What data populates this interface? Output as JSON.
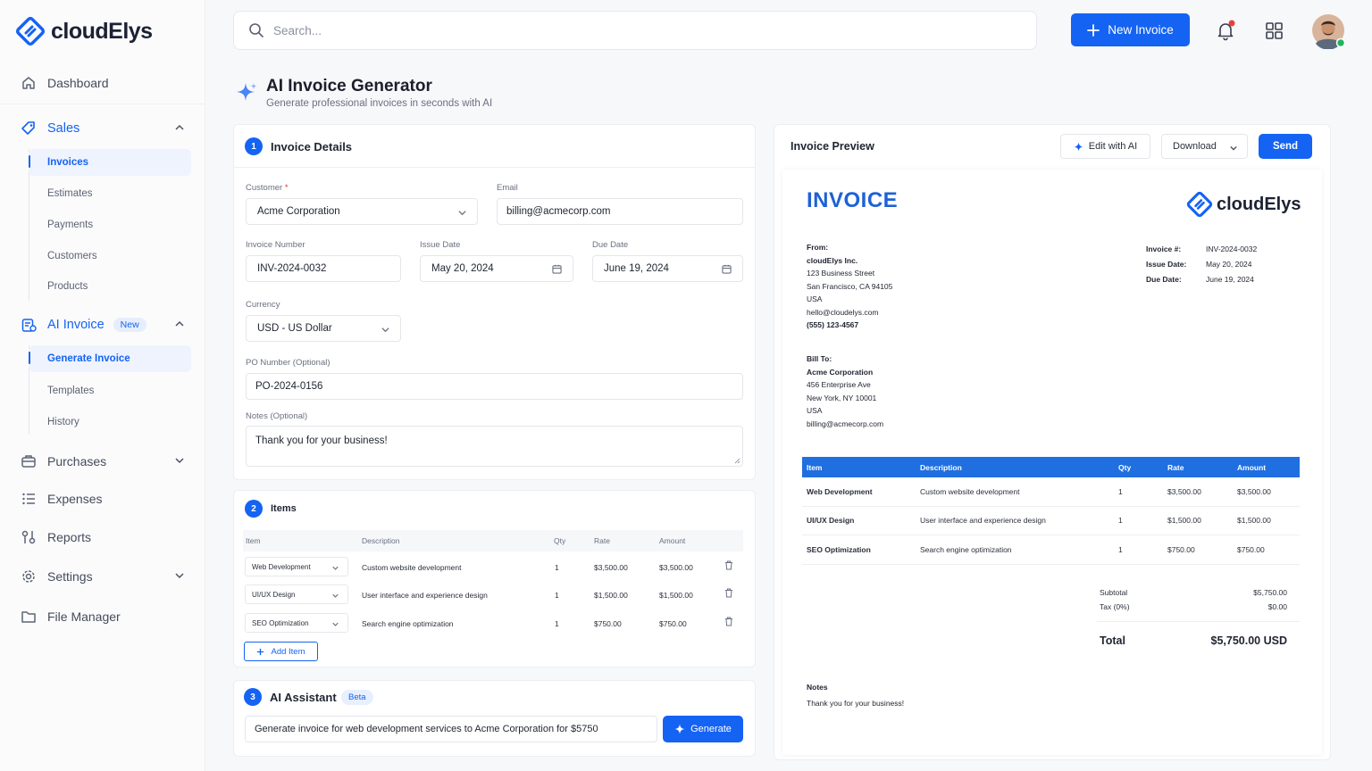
{
  "brand": {
    "name": "cloudElys"
  },
  "sidebar": {
    "dashboard": "Dashboard",
    "sales": {
      "label": "Sales",
      "items": [
        "Invoices",
        "Estimates",
        "Payments",
        "Customers",
        "Products"
      ]
    },
    "ai_invoice": {
      "label": "AI Invoice",
      "badge": "New",
      "items": [
        "Generate Invoice",
        "Templates",
        "History"
      ]
    },
    "purchases": "Purchases",
    "expenses": "Expenses",
    "reports": "Reports",
    "settings": "Settings",
    "file_manager": "File Manager"
  },
  "topbar": {
    "search_placeholder": "Search...",
    "new_invoice": "New Invoice"
  },
  "page": {
    "title": "AI Invoice Generator",
    "subtitle": "Generate professional invoices in seconds with AI"
  },
  "details": {
    "step": "1",
    "title": "Invoice Details",
    "customer_label": "Customer",
    "customer_req": "*",
    "customer_value": "Acme Corporation",
    "email_label": "Email",
    "email_value": "billing@acmecorp.com",
    "invoice_number_label": "Invoice Number",
    "invoice_number_value": "INV-2024-0032",
    "issue_date_label": "Issue Date",
    "issue_date_value": "May 20, 2024",
    "due_date_label": "Due Date",
    "due_date_value": "June 19, 2024",
    "currency_label": "Currency",
    "currency_value": "USD - US Dollar",
    "po_label": "PO Number (Optional)",
    "po_value": "PO-2024-0156",
    "notes_label": "Notes (Optional)",
    "notes_value": "Thank you for your business!"
  },
  "items": {
    "step": "2",
    "title": "Items",
    "headers": {
      "item": "Item",
      "description": "Description",
      "qty": "Qty",
      "rate": "Rate",
      "amount": "Amount"
    },
    "rows": [
      {
        "item": "Web Development",
        "description": "Custom website development",
        "qty": "1",
        "rate": "$3,500.00",
        "amount": "$3,500.00"
      },
      {
        "item": "UI/UX Design",
        "description": "User interface and experience design",
        "qty": "1",
        "rate": "$1,500.00",
        "amount": "$1,500.00"
      },
      {
        "item": "SEO Optimization",
        "description": "Search engine optimization",
        "qty": "1",
        "rate": "$750.00",
        "amount": "$750.00"
      }
    ],
    "add_item": "Add Item"
  },
  "assistant": {
    "step": "3",
    "title": "AI Assistant",
    "badge": "Beta",
    "prompt": "Generate invoice for web development services to Acme Corporation for $5750",
    "generate": "Generate"
  },
  "preview": {
    "title": "Invoice Preview",
    "edit_ai": "Edit with AI",
    "download": "Download",
    "send": "Send",
    "heading": "INVOICE",
    "from_label": "From:",
    "from_lines": [
      "cloudElys Inc.",
      "123 Business Street",
      "San Francisco, CA 94105",
      "USA",
      "hello@cloudelys.com",
      "(555) 123-4567"
    ],
    "meta": [
      {
        "label": "Invoice #:",
        "value": "INV-2024-0032"
      },
      {
        "label": "Issue Date:",
        "value": "May 20, 2024"
      },
      {
        "label": "Due Date:",
        "value": "June 19, 2024"
      }
    ],
    "bill_label": "Bill To:",
    "bill_lines": [
      "Acme Corporation",
      "456 Enterprise Ave",
      "New York, NY 10001",
      "USA",
      "billing@acmecorp.com"
    ],
    "headers": {
      "item": "Item",
      "description": "Description",
      "qty": "Qty",
      "rate": "Rate",
      "amount": "Amount"
    },
    "rows": [
      {
        "item": "Web Development",
        "description": "Custom website development",
        "qty": "1",
        "rate": "$3,500.00",
        "amount": "$3,500.00"
      },
      {
        "item": "UI/UX Design",
        "description": "User interface and experience design",
        "qty": "1",
        "rate": "$1,500.00",
        "amount": "$1,500.00"
      },
      {
        "item": "SEO Optimization",
        "description": "Search engine optimization",
        "qty": "1",
        "rate": "$750.00",
        "amount": "$750.00"
      }
    ],
    "subtotal_label": "Subtotal",
    "subtotal_value": "$5,750.00",
    "tax_label": "Tax (0%)",
    "tax_value": "$0.00",
    "total_label": "Total",
    "total_value": "$5,750.00 USD",
    "notes_label": "Notes",
    "notes_value": "Thank you for your business!"
  },
  "colors": {
    "accent": "#1463f3",
    "table_header": "#1f6fe0"
  }
}
